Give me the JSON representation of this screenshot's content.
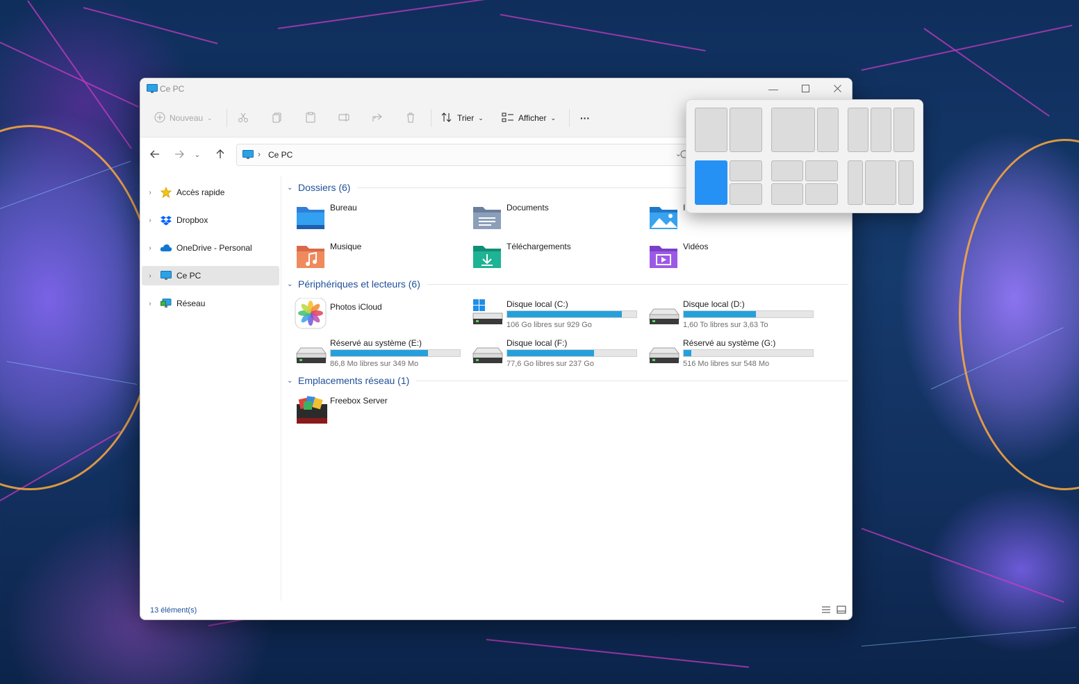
{
  "window": {
    "title": "Ce PC",
    "controls": {
      "minimize": "minimize-icon",
      "maximize": "maximize-icon",
      "close": "close-icon"
    }
  },
  "toolbar": {
    "new_label": "Nouveau",
    "sort_label": "Trier",
    "view_label": "Afficher",
    "more_label": "···"
  },
  "address": {
    "separator": "›",
    "crumb": "Ce PC"
  },
  "sidebar": {
    "items": [
      {
        "label": "Accès rapide",
        "icon": "star-icon"
      },
      {
        "label": "Dropbox",
        "icon": "dropbox-icon"
      },
      {
        "label": "OneDrive - Personal",
        "icon": "cloud-icon"
      },
      {
        "label": "Ce PC",
        "icon": "computer-icon",
        "selected": true
      },
      {
        "label": "Réseau",
        "icon": "network-icon"
      }
    ]
  },
  "sections": {
    "folders": {
      "title": "Dossiers (6)"
    },
    "devices": {
      "title": "Périphériques et lecteurs (6)"
    },
    "network": {
      "title": "Emplacements réseau (1)"
    }
  },
  "folders": [
    {
      "name": "Bureau",
      "icon": "desktop-folder-icon"
    },
    {
      "name": "Documents",
      "icon": "documents-folder-icon"
    },
    {
      "name": "I",
      "icon": "pictures-folder-icon"
    },
    {
      "name": "Musique",
      "icon": "music-folder-icon"
    },
    {
      "name": "Téléchargements",
      "icon": "downloads-folder-icon"
    },
    {
      "name": "Vidéos",
      "icon": "videos-folder-icon"
    }
  ],
  "drives": [
    {
      "name": "Photos iCloud",
      "icon": "icloud-photos-icon"
    },
    {
      "name": "Disque local (C:)",
      "free": "106 Go libres sur 929 Go",
      "used_fraction": 0.886
    },
    {
      "name": "Disque local (D:)",
      "free": "1,60 To libres sur 3,63 To",
      "used_fraction": 0.559
    },
    {
      "name": "Réservé au système (E:)",
      "free": "86,8 Mo libres sur 349 Mo",
      "used_fraction": 0.751
    },
    {
      "name": "Disque local (F:)",
      "free": "77,6 Go libres sur 237 Go",
      "used_fraction": 0.673
    },
    {
      "name": "Réservé au système (G:)",
      "free": "516 Mo libres sur 548 Mo",
      "used_fraction": 0.058
    }
  ],
  "network_locations": [
    {
      "name": "Freebox Server",
      "icon": "freebox-server-icon"
    }
  ],
  "status": {
    "count": "13 élément(s)"
  },
  "colors": {
    "accent": "#2591f5",
    "drive_bar": "#26a0da",
    "section_title": "#1f4f9a"
  }
}
